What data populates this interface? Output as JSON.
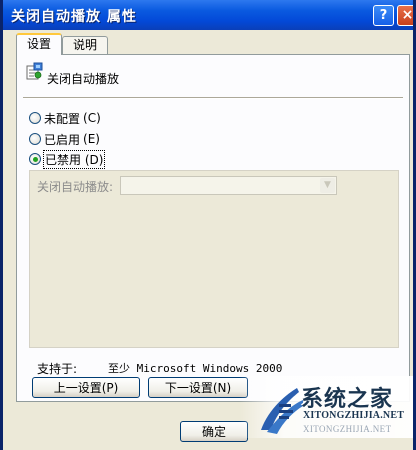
{
  "window": {
    "title": "关闭自动播放 属性",
    "help_glyph": "?",
    "close_glyph": "×"
  },
  "tabs": [
    {
      "label": "设置",
      "active": true
    },
    {
      "label": "说明",
      "active": false
    }
  ],
  "policy": {
    "icon": "policy-setting-icon",
    "name": "关闭自动播放"
  },
  "radios": [
    {
      "label": "未配置",
      "hotkey": "(C)",
      "checked": false
    },
    {
      "label": "已启用",
      "hotkey": "(E)",
      "checked": false
    },
    {
      "label": "已禁用",
      "hotkey": "(D)",
      "checked": true
    }
  ],
  "options": {
    "label": "关闭自动播放:",
    "combo_value": ""
  },
  "support": {
    "label": "支持于:",
    "value": "至少 Microsoft Windows 2000"
  },
  "buttons": {
    "prev": "上一设置(P)",
    "next": "下一设置(N)",
    "ok": "确定"
  },
  "watermark": {
    "logo_text": "系统之家",
    "url": "XITONGZHIJIA.NET",
    "url_faded": "XITONGZHIJIA.NET"
  },
  "colors": {
    "titlebar": "#0a5ae0",
    "dialog_bg": "#ece9d8",
    "tab_highlight": "#ffc83c",
    "radio_check": "#21a121"
  }
}
